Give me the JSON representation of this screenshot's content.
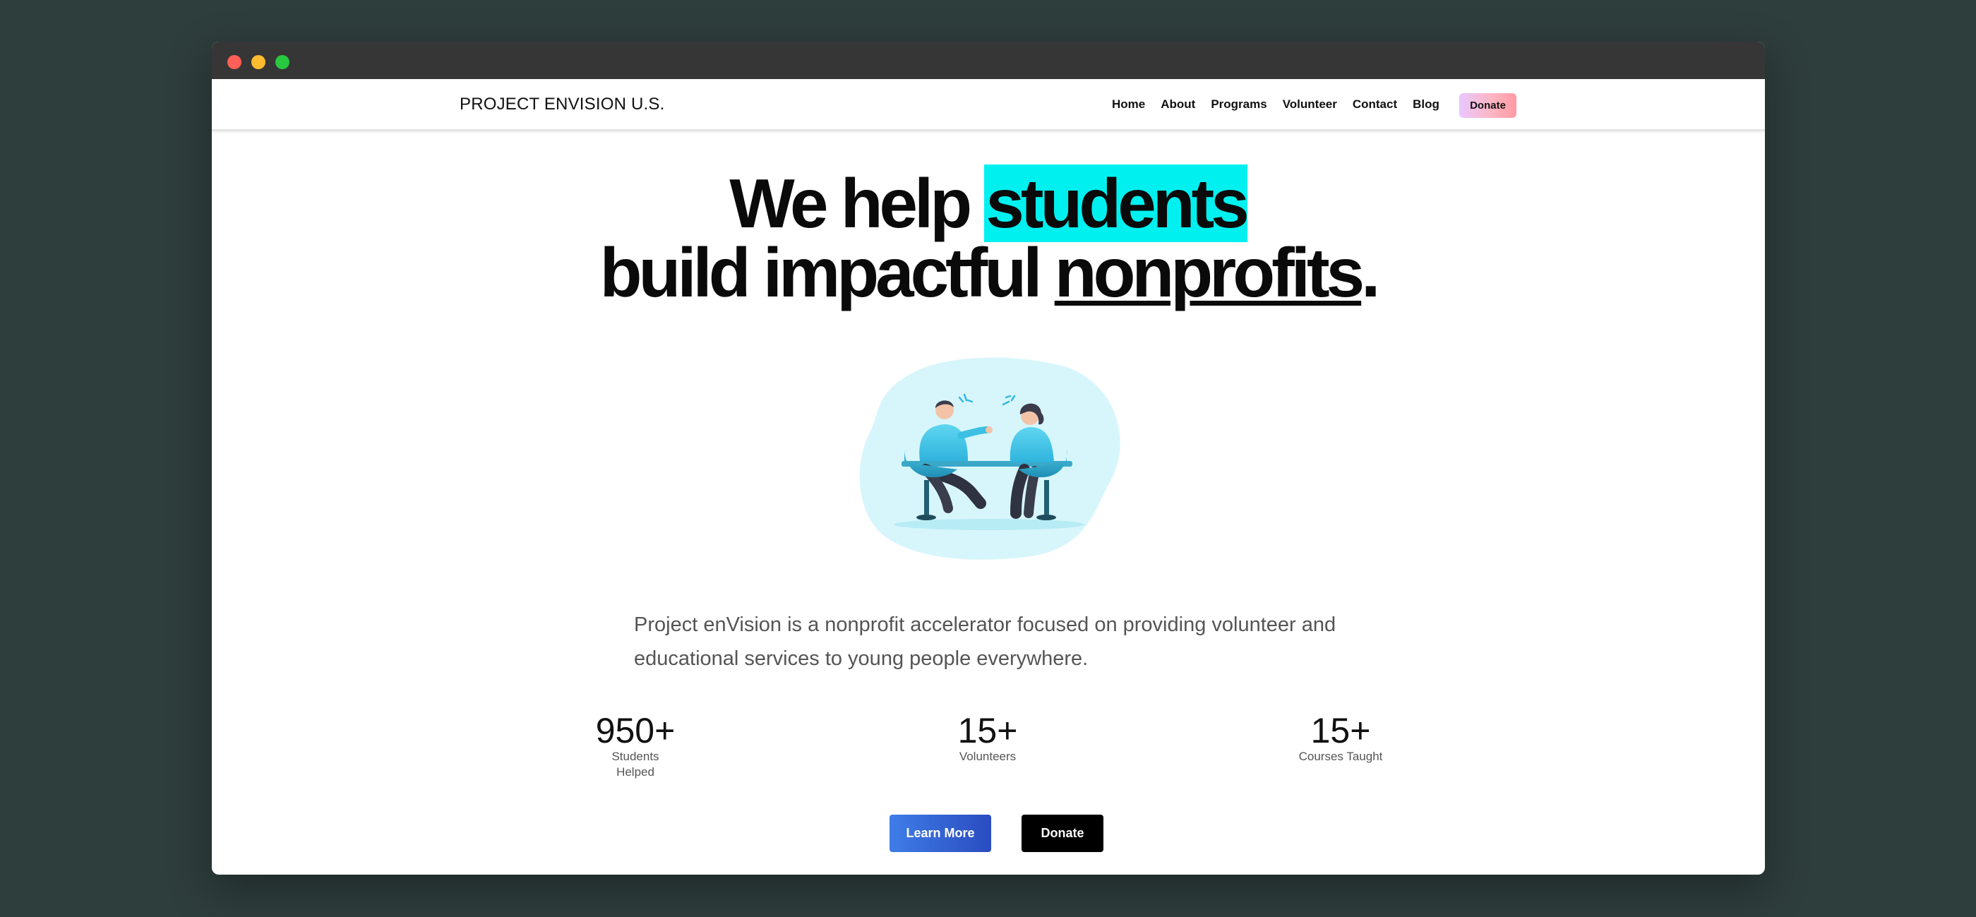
{
  "brand": "PROJECT ENVISION U.S.",
  "nav": {
    "links": [
      "Home",
      "About",
      "Programs",
      "Volunteer",
      "Contact",
      "Blog"
    ],
    "donate_label": "Donate",
    "donate_colors": [
      "#e8c8ff",
      "#ff9aa4"
    ]
  },
  "hero": {
    "line1_pre": "We help ",
    "line1_highlight": "students",
    "line2_pre": "build impactful ",
    "line2_underline": "nonprofits",
    "line2_post": ".",
    "highlight_color": "#00f0f0"
  },
  "illustration": {
    "icon": "two-people-talking-illustration"
  },
  "description": "Project enVision is a nonprofit accelerator focused on providing volunteer and educational services to young people everywhere.",
  "stats": [
    {
      "value": "950+",
      "label": "Students Helped"
    },
    {
      "value": "15+",
      "label": "Volunteers"
    },
    {
      "value": "15+",
      "label": "Courses Taught"
    }
  ],
  "buttons": {
    "learn_more": "Learn More",
    "donate": "Donate"
  }
}
